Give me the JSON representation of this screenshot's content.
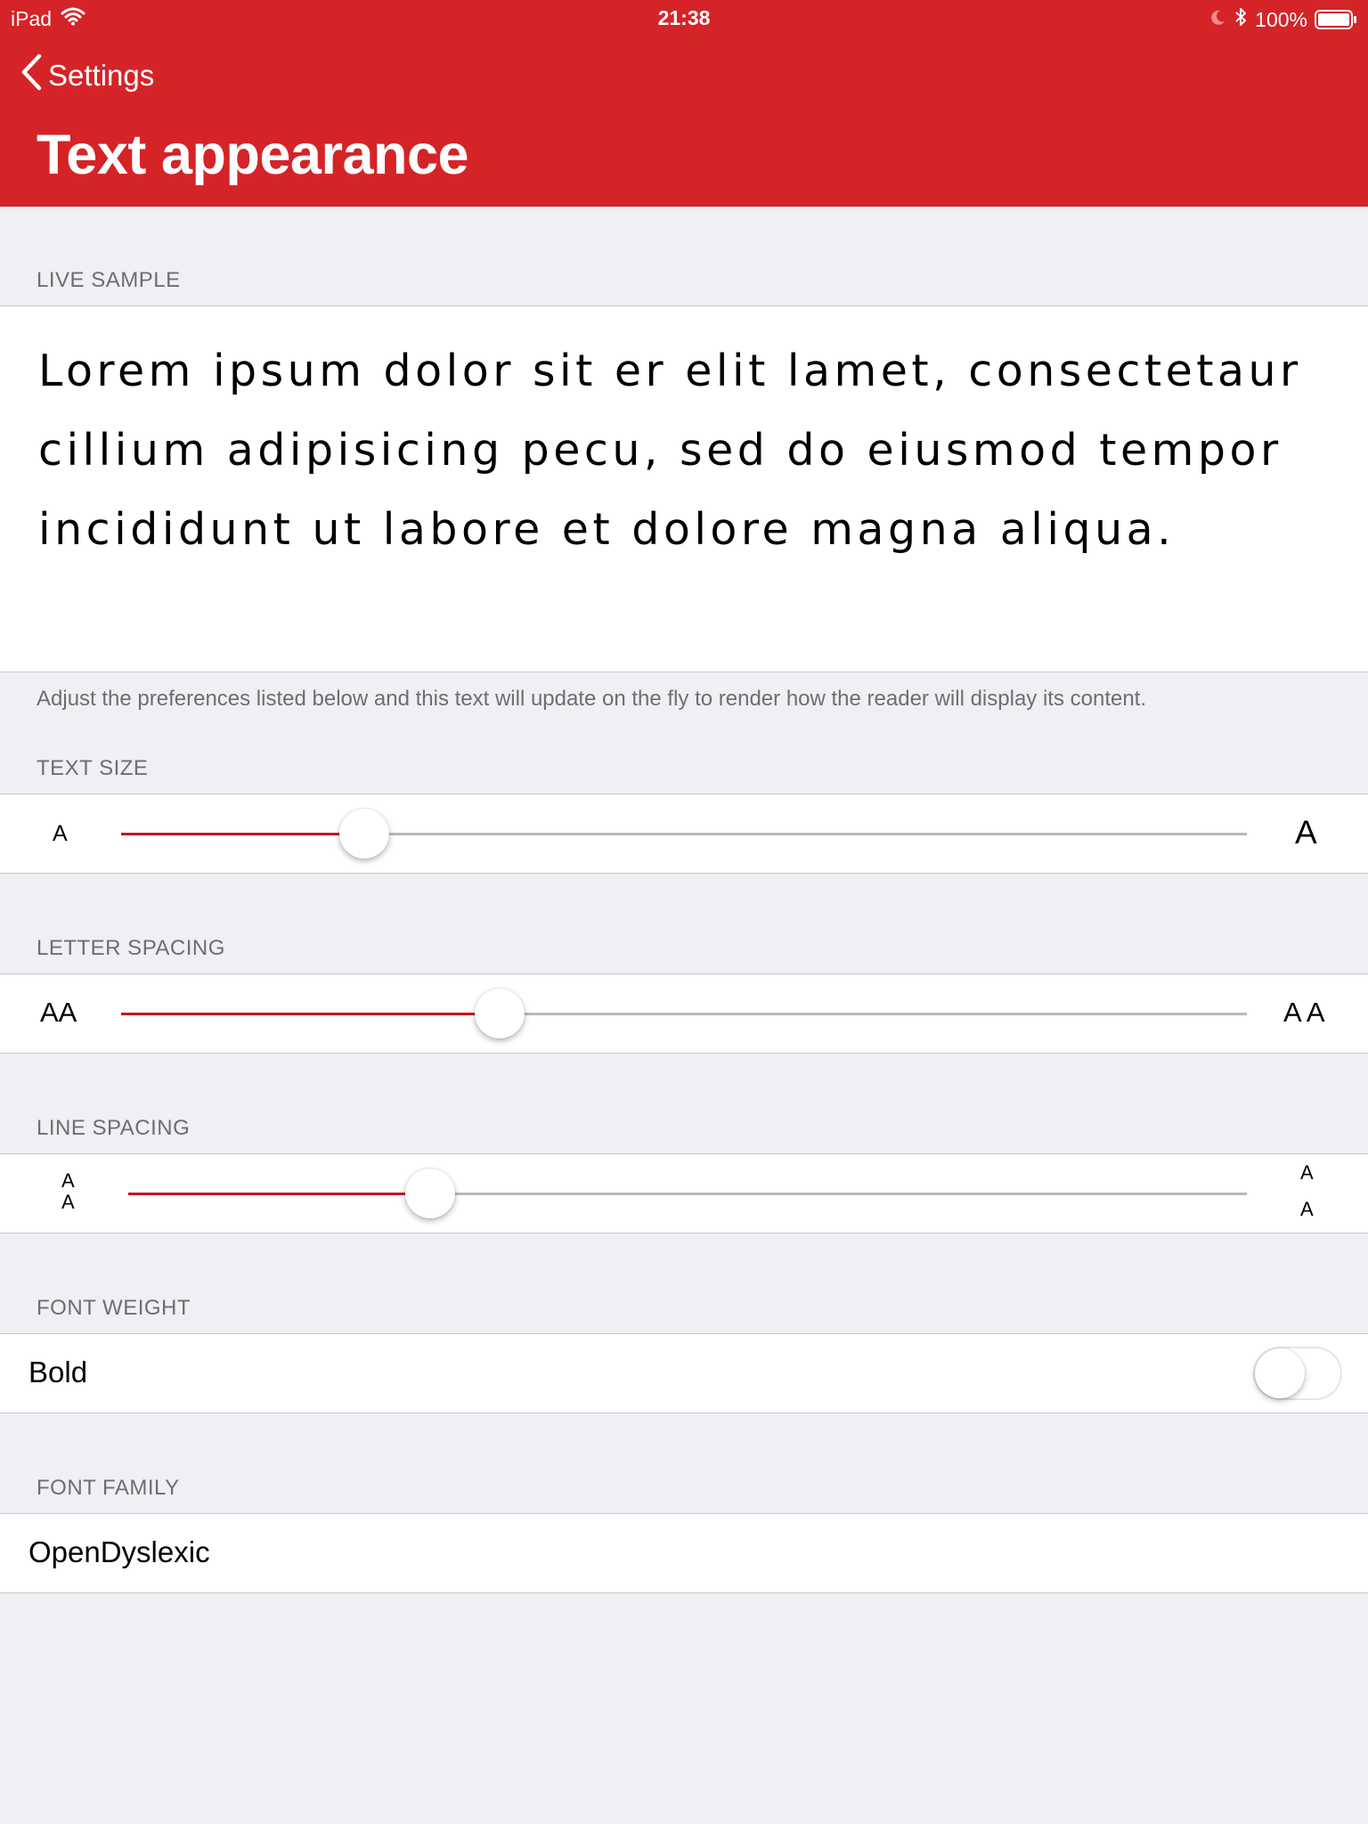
{
  "status_bar": {
    "device": "iPad",
    "time": "21:38",
    "battery": "100%"
  },
  "nav": {
    "back_label": "Settings",
    "title": "Text appearance"
  },
  "live_sample": {
    "header": "LIVE SAMPLE",
    "text": "Lorem ipsum dolor sit er elit lamet, consectetaur cillium adipisicing pecu, sed do eiusmod tempor incididunt ut labore et dolore magna aliqua.",
    "footer": "Adjust the preferences listed below and this text will update on the fly to render how the reader will display its content."
  },
  "text_size": {
    "header": "TEXT SIZE",
    "min_glyph": "A",
    "max_glyph": "A",
    "value": 0.216
  },
  "letter_spacing": {
    "header": "LETTER SPACING",
    "min_glyph": "AA",
    "max_glyph": "A A",
    "value": 0.336
  },
  "line_spacing": {
    "header": "LINE SPACING",
    "min_glyph_top": "A",
    "min_glyph_bottom": "A",
    "max_glyph_top": "A",
    "max_glyph_bottom": "A",
    "value": 0.27
  },
  "font_weight": {
    "header": "FONT WEIGHT",
    "label": "Bold",
    "enabled": false
  },
  "font_family": {
    "header": "FONT FAMILY",
    "value": "OpenDyslexic"
  },
  "colors": {
    "accent": "#d42428",
    "slider_fill": "#c8161c",
    "track": "#b8b8bd",
    "background": "#efeff4",
    "secondary_text": "#6d6d72"
  }
}
